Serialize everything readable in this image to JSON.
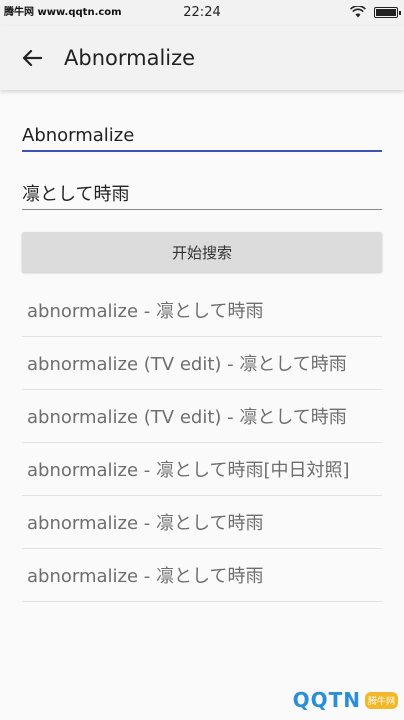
{
  "status_bar": {
    "carrier": "腾牛网 www.qqtn.com",
    "time": "22:24"
  },
  "app_bar": {
    "title": "Abnormalize",
    "back_icon": "arrow-left-icon"
  },
  "form": {
    "song_value": "Abnormalize",
    "artist_value": "凛として時雨",
    "search_label": "开始搜索"
  },
  "results": [
    "abnormalize - 凛として時雨",
    "abnormalize (TV edit) - 凛として時雨",
    "abnormalize (TV edit) - 凛として時雨",
    "abnormalize - 凛として時雨[中日対照]",
    "abnormalize - 凛として時雨",
    "abnormalize - 凛として時雨"
  ],
  "watermark": {
    "logo_text": "QQTN",
    "badge": "腾牛网"
  },
  "colors": {
    "accent": "#3f51b5",
    "result_text": "#6e6e6e",
    "button_bg": "#dcdcdc"
  }
}
